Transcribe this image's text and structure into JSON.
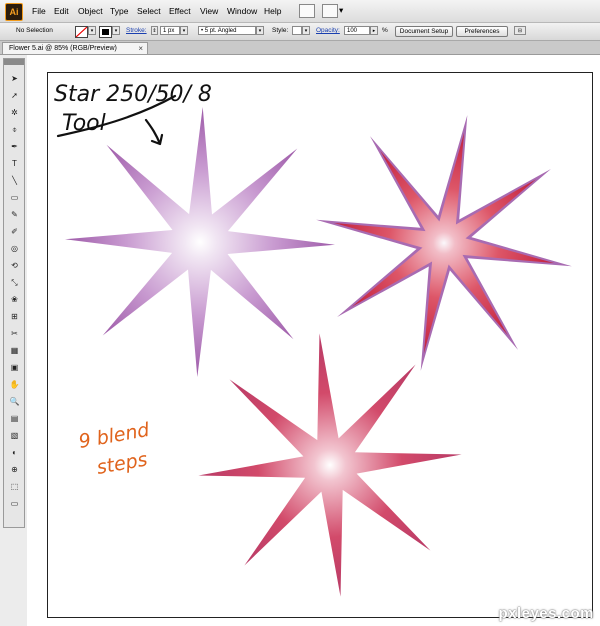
{
  "menubar": {
    "app_icon": "Ai",
    "items": [
      "File",
      "Edit",
      "Object",
      "Type",
      "Select",
      "Effect",
      "View",
      "Window",
      "Help"
    ]
  },
  "control_bar": {
    "selection": "No Selection",
    "stroke_label": "Stroke:",
    "stroke_value": "1 px",
    "brush_value": "5 pt. Angled",
    "style_label": "Style:",
    "opacity_label": "Opacity:",
    "opacity_value": "100",
    "opacity_unit": "%",
    "document_setup": "Document Setup",
    "preferences": "Preferences"
  },
  "document": {
    "tab_title": "Flower 5.ai @ 85% (RGB/Preview)",
    "close_glyph": "×"
  },
  "tools": [
    "➤",
    "➚",
    "✲",
    "⌽",
    "✒",
    "T",
    "╲",
    "▭",
    "✎",
    "✐",
    "◎",
    "⟲",
    "⤡",
    "❀",
    "⊞",
    "✂",
    "▦",
    "▣",
    "✋",
    "🔍",
    "▤",
    "▧",
    "◐",
    "⊕",
    "⬚",
    "▭"
  ],
  "annotations": {
    "top_left": [
      "Star 250/50/ 8",
      "Tool"
    ],
    "blend": [
      "9 blend",
      "steps"
    ]
  },
  "colors": {
    "star_purple": "#9e5ba9",
    "star_red": "#d4283f",
    "star_glow": "#ffffff",
    "annotation_orange": "#e0631c",
    "annotation_black": "#111111"
  },
  "watermark": "pxleyes.com"
}
